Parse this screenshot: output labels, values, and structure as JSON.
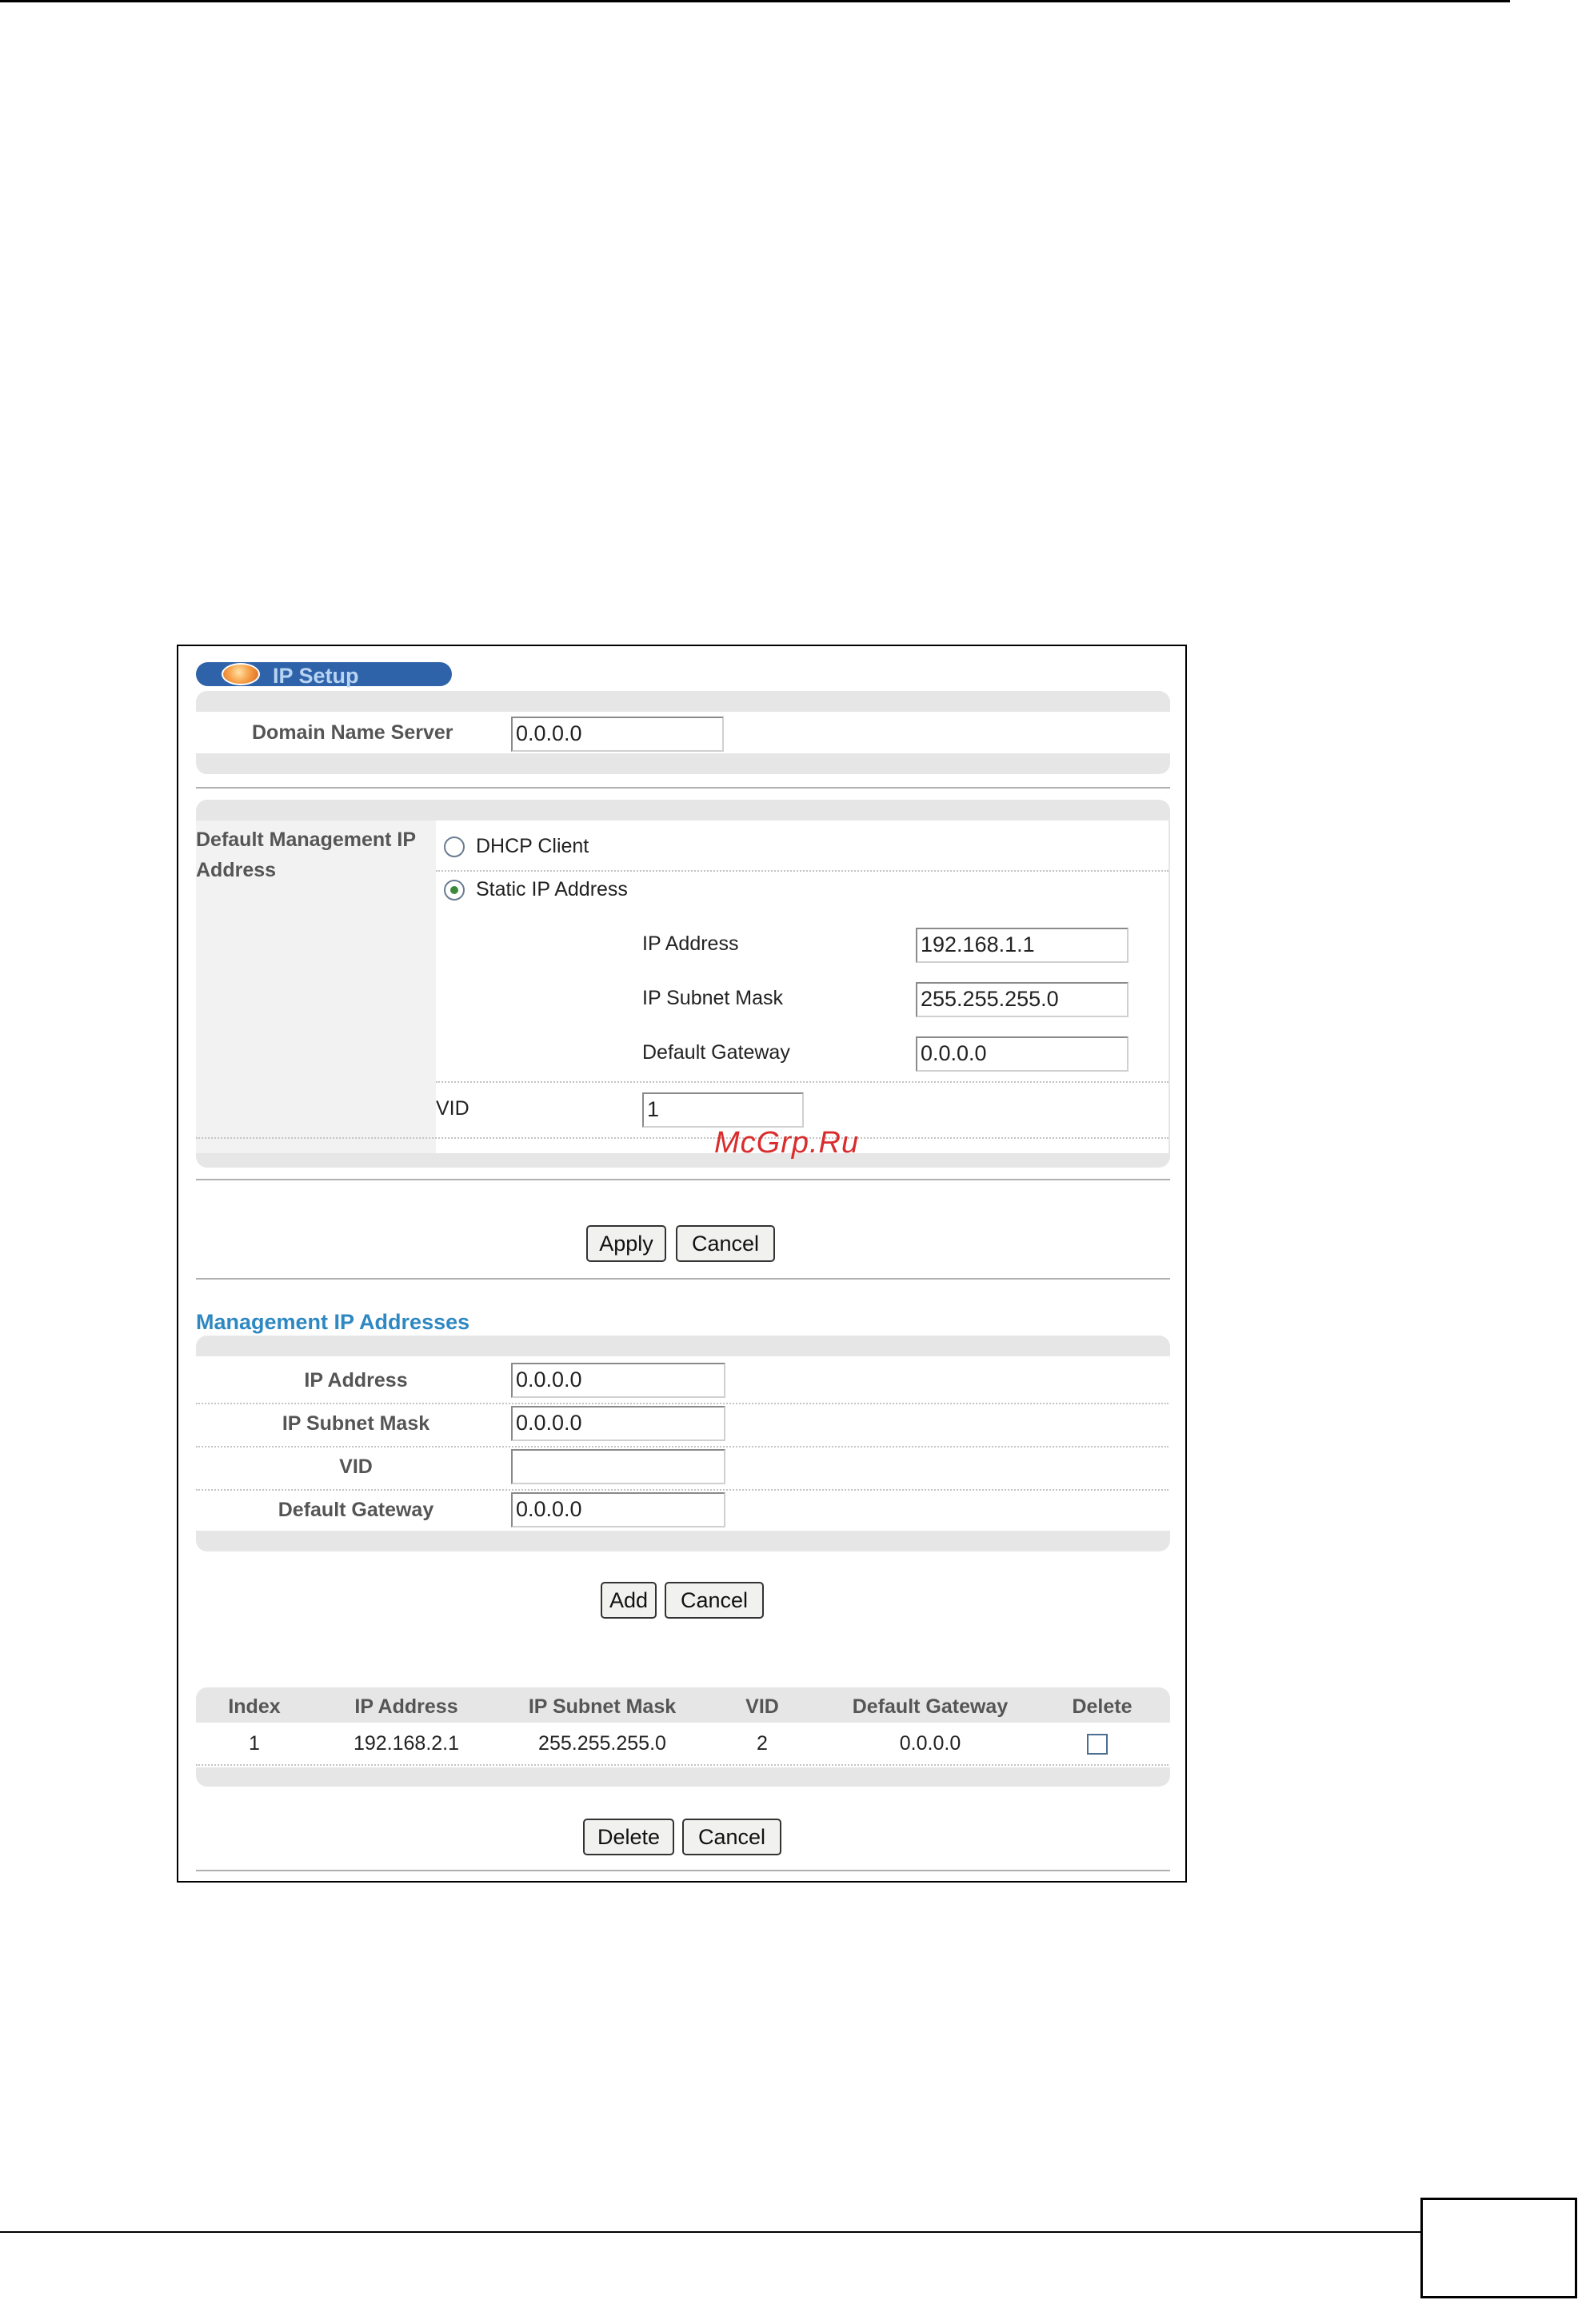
{
  "panel": {
    "title": "IP Setup"
  },
  "dns": {
    "label": "Domain Name Server",
    "value": "0.0.0.0"
  },
  "default_mgmt": {
    "label_line1": "Default Management IP",
    "label_line2": "Address",
    "dhcp_label": "DHCP Client",
    "static_label": "Static IP Address",
    "selected": "static",
    "ip_label": "IP Address",
    "ip_value": "192.168.1.1",
    "mask_label": "IP Subnet Mask",
    "mask_value": "255.255.255.0",
    "gateway_label": "Default Gateway",
    "gateway_value": "0.0.0.0",
    "vid_label": "VID",
    "vid_value": "1"
  },
  "watermark": "McGrp.Ru",
  "actions1": {
    "apply": "Apply",
    "cancel": "Cancel"
  },
  "mgmt": {
    "heading": "Management IP Addresses",
    "ip_label": "IP Address",
    "ip_value": "0.0.0.0",
    "mask_label": "IP Subnet Mask",
    "mask_value": "0.0.0.0",
    "vid_label": "VID",
    "vid_value": "",
    "gateway_label": "Default Gateway",
    "gateway_value": "0.0.0.0"
  },
  "actions2": {
    "add": "Add",
    "cancel": "Cancel"
  },
  "table": {
    "headers": [
      "Index",
      "IP Address",
      "IP Subnet Mask",
      "VID",
      "Default Gateway",
      "Delete"
    ],
    "rows": [
      {
        "index": "1",
        "ip": "192.168.2.1",
        "mask": "255.255.255.0",
        "vid": "2",
        "gateway": "0.0.0.0",
        "delete": false
      }
    ]
  },
  "actions3": {
    "delete": "Delete",
    "cancel": "Cancel"
  }
}
